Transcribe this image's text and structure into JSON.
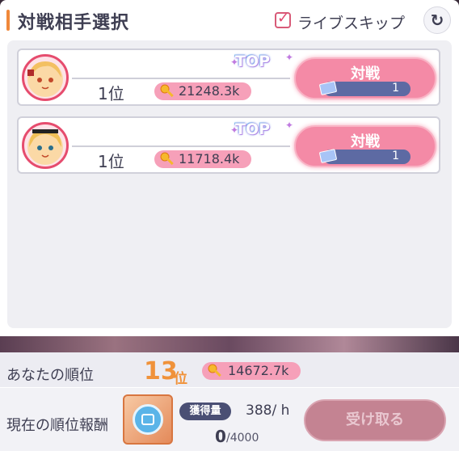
{
  "header": {
    "title": "対戦相手選択",
    "live_skip_label": "ライブスキップ",
    "live_skip_checked": true
  },
  "opponents": [
    {
      "rank": "1位",
      "score": "21248.3k",
      "top_badge": "TOP",
      "battle_label": "対戦",
      "ticket_count": "1"
    },
    {
      "rank": "1位",
      "score": "11718.4k",
      "top_badge": "TOP",
      "battle_label": "対戦",
      "ticket_count": "1"
    }
  ],
  "footer": {
    "your_rank_label": "あなたの順位",
    "your_rank": "13",
    "your_rank_unit": "位",
    "your_score": "14672.7k",
    "reward_label": "現在の順位報酬",
    "gain_badge": "獲得量",
    "gain_rate": "388/ h",
    "progress_value": "0",
    "progress_max": "/4000",
    "receive_label": "受け取る"
  },
  "colors": {
    "accent_orange": "#f0923a",
    "battle_pink": "#f48aa6",
    "score_pill": "#f6a0b9",
    "receive_disabled": "#c48392"
  }
}
